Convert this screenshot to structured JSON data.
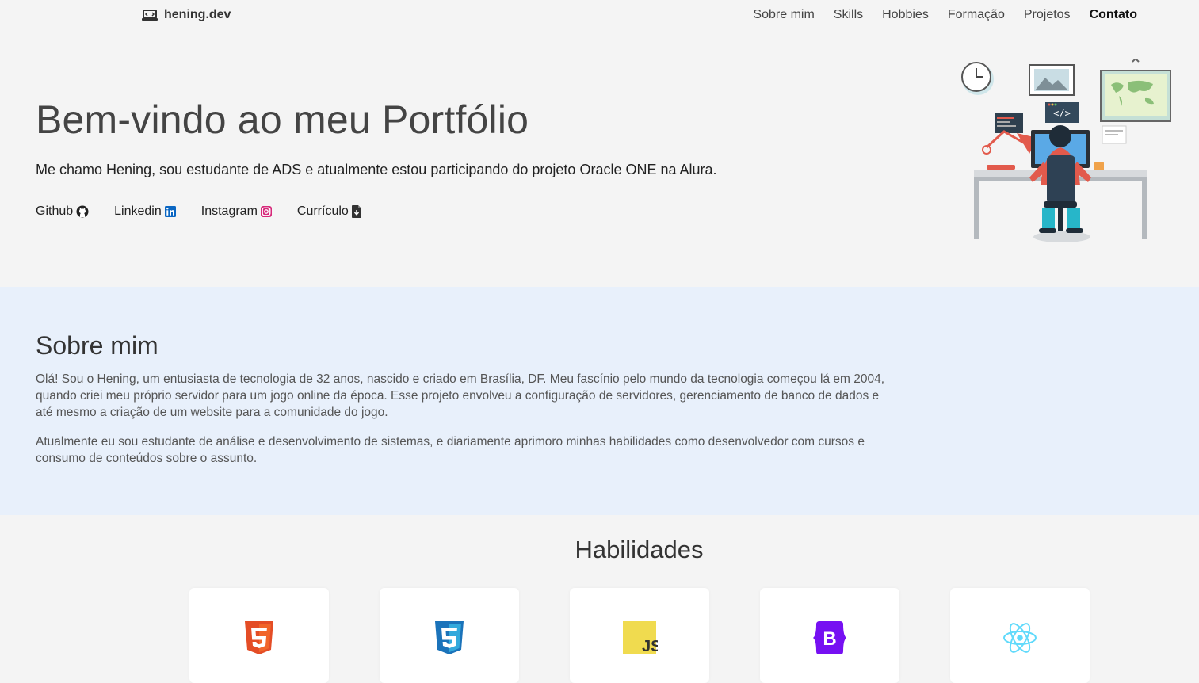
{
  "nav": {
    "brand": "hening.dev",
    "brand_icon": "laptop-code-icon",
    "links": [
      "Sobre mim",
      "Skills",
      "Hobbies",
      "Formação",
      "Projetos",
      "Contato"
    ]
  },
  "hero": {
    "title": "Bem-vindo ao meu Portfólio",
    "subtitle": "Me chamo Hening, sou estudante de ADS e atualmente estou participando do projeto Oracle ONE na Alura.",
    "social": [
      {
        "label": "Github",
        "icon": "github-icon"
      },
      {
        "label": "Linkedin",
        "icon": "linkedin-icon"
      },
      {
        "label": "Instagram",
        "icon": "instagram-icon"
      },
      {
        "label": "Currículo",
        "icon": "file-download-icon"
      }
    ],
    "illustration": "developer-at-desk-illustration"
  },
  "about": {
    "title": "Sobre mim",
    "p1": "Olá! Sou o Hening, um entusiasta de tecnologia de 32 anos, nascido e criado em Brasília, DF. Meu fascínio pelo mundo da tecnologia começou lá em 2004, quando criei meu próprio servidor para um jogo online da época. Esse projeto envolveu a configuração de servidores, gerenciamento de banco de dados e até mesmo a criação de um website para a comunidade do jogo.",
    "p2": "Atualmente eu sou estudante de análise e desenvolvimento de sistemas, e diariamente aprimoro minhas habilidades como desenvolvedor com cursos e consumo de conteúdos sobre o assunto."
  },
  "skills": {
    "title": "Habilidades",
    "items": [
      {
        "icon": "html5-icon",
        "color": "#f16529"
      },
      {
        "icon": "css3-icon",
        "color": "#33a9dc"
      },
      {
        "icon": "javascript-icon",
        "color": "#f0db4f"
      },
      {
        "icon": "bootstrap-icon",
        "color": "#7610f2"
      },
      {
        "icon": "react-icon",
        "color": "#61dafb"
      }
    ]
  },
  "colors": {
    "page_bg": "#f4f4f4",
    "about_bg": "#e8f0fb",
    "linkedin": "#0a66c2",
    "instagram": "#d6297a"
  }
}
